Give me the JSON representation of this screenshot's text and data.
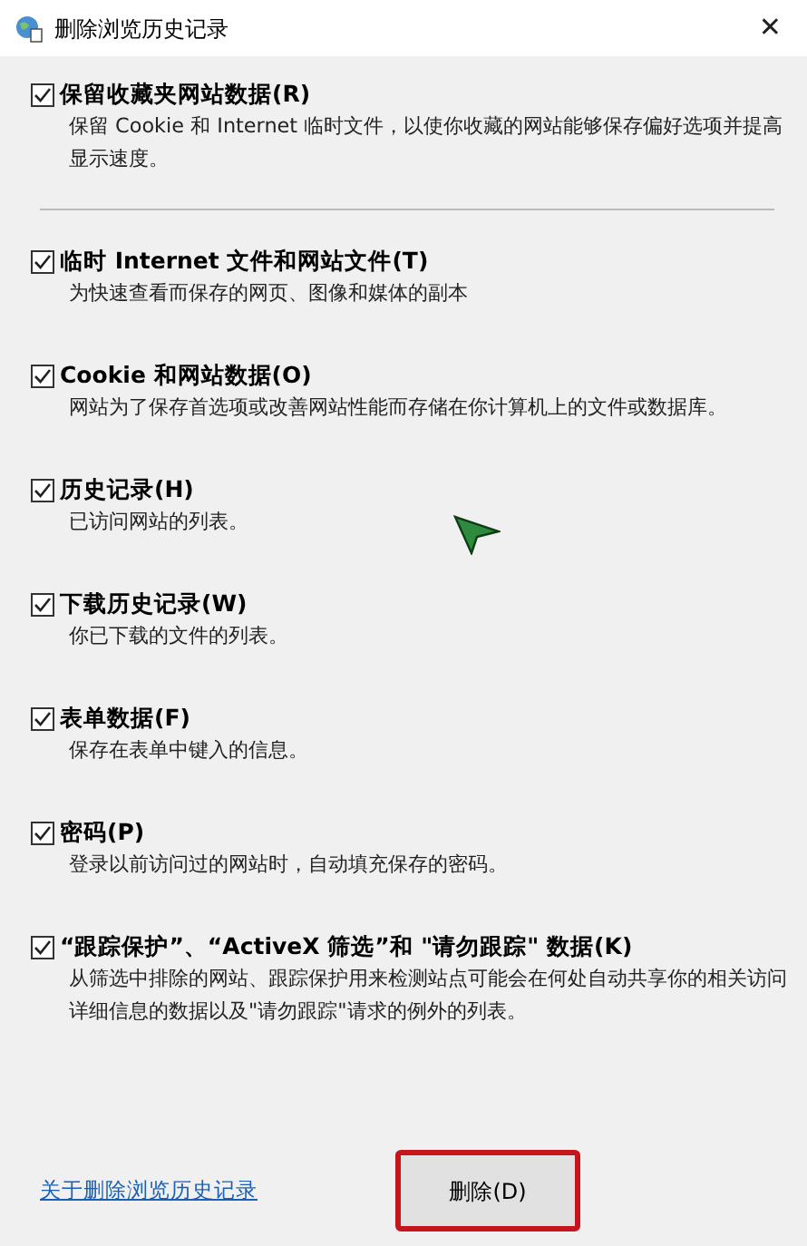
{
  "window": {
    "title": "删除浏览历史记录",
    "close": "✕"
  },
  "options": [
    {
      "label": "保留收藏夹网站数据(R)",
      "description": "保留 Cookie 和 Internet 临时文件，以使你收藏的网站能够保存偏好选项并提高显示速度。",
      "checked": true,
      "divider_after": true
    },
    {
      "label": "临时 Internet 文件和网站文件(T)",
      "description": "为快速查看而保存的网页、图像和媒体的副本",
      "checked": true
    },
    {
      "label": "Cookie 和网站数据(O)",
      "description": "网站为了保存首选项或改善网站性能而存储在你计算机上的文件或数据库。",
      "checked": true
    },
    {
      "label": "历史记录(H)",
      "description": "已访问网站的列表。",
      "checked": true
    },
    {
      "label": "下载历史记录(W)",
      "description": "你已下载的文件的列表。",
      "checked": true
    },
    {
      "label": "表单数据(F)",
      "description": "保存在表单中键入的信息。",
      "checked": true
    },
    {
      "label": "密码(P)",
      "description": "登录以前访问过的网站时，自动填充保存的密码。",
      "checked": true
    },
    {
      "label": "“跟踪保护”、“ActiveX 筛选”和 \"请勿跟踪\" 数据(K)",
      "description": "从筛选中排除的网站、跟踪保护用来检测站点可能会在何处自动共享你的相关访问详细信息的数据以及\"请勿跟踪\"请求的例外的列表。",
      "checked": true
    }
  ],
  "footer": {
    "link": "关于删除浏览历史记录",
    "button": {
      "label": "删除(D)",
      "highlighted": true
    }
  }
}
